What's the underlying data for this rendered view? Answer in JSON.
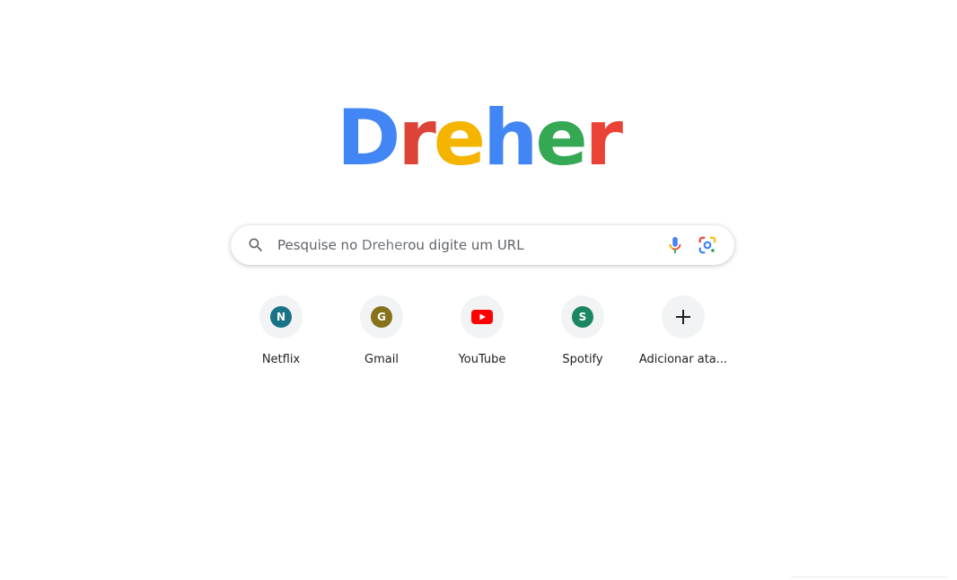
{
  "logo": {
    "letters": [
      {
        "char": "D",
        "color": "#4285f4"
      },
      {
        "char": "r",
        "color": "#db4437"
      },
      {
        "char": "e",
        "color": "#f4b400"
      },
      {
        "char": "h",
        "color": "#4285f4"
      },
      {
        "char": "e",
        "color": "#34a853"
      },
      {
        "char": "r",
        "color": "#ea4335"
      }
    ]
  },
  "search": {
    "placeholder_prefix": "Pesquise no ",
    "placeholder_brand": "Dreher",
    "placeholder_suffix": "ou digite um URL",
    "icons": [
      "search-icon",
      "microphone-icon",
      "google-lens-icon"
    ]
  },
  "shortcuts": [
    {
      "label": "Netflix",
      "initial": "N",
      "color": "#1a7286",
      "icon": "letter-badge"
    },
    {
      "label": "Gmail",
      "initial": "G",
      "color": "#86721a",
      "icon": "letter-badge"
    },
    {
      "label": "YouTube",
      "initial": "",
      "color": "#ff0000",
      "icon": "youtube-icon"
    },
    {
      "label": "Spotify",
      "initial": "S",
      "color": "#1a8662",
      "icon": "letter-badge"
    },
    {
      "label": "Adicionar ata...",
      "initial": "",
      "color": "#202124",
      "icon": "plus-icon"
    }
  ]
}
